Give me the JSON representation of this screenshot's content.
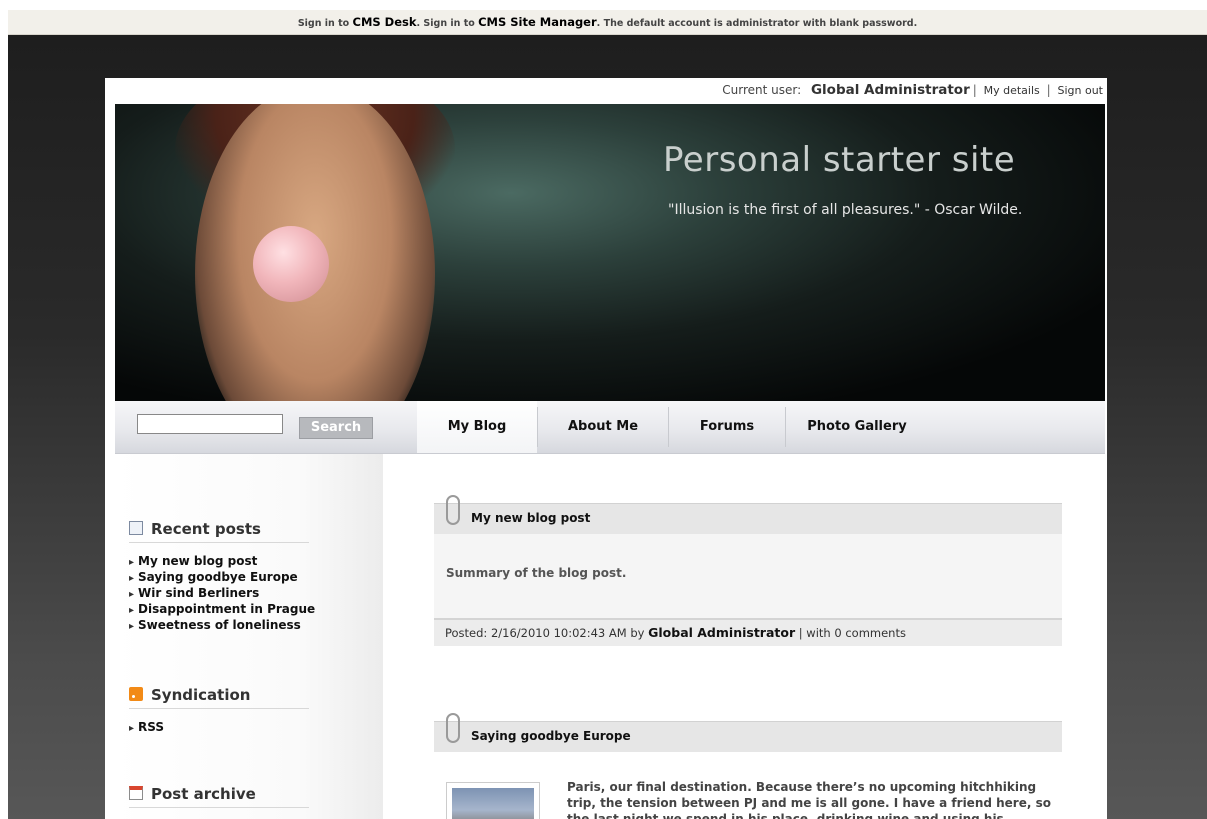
{
  "topbar": {
    "pre1": "Sign in to",
    "cms_desk": "CMS Desk",
    "mid": ". Sign in to",
    "site_manager": "CMS Site Manager",
    "post": ". The default account is administrator with blank password."
  },
  "user": {
    "label": "Current user:",
    "name": "Global Administrator",
    "my_details": "My details",
    "sign_out": "Sign out"
  },
  "banner": {
    "title": "Personal starter site",
    "quote": "\"Illusion is the first of all pleasures.\" - Oscar Wilde."
  },
  "search": {
    "button": "Search",
    "value": ""
  },
  "nav": {
    "items": [
      {
        "label": "My Blog"
      },
      {
        "label": "About Me"
      },
      {
        "label": "Forums"
      },
      {
        "label": "Photo Gallery"
      }
    ]
  },
  "sidebar": {
    "recent_title": "Recent posts",
    "recent": [
      "My new blog post",
      "Saying goodbye Europe",
      "Wir sind Berliners",
      "Disappointment in Prague",
      "Sweetness of loneliness"
    ],
    "syndication_title": "Syndication",
    "syndication": [
      "RSS"
    ],
    "archive_title": "Post archive"
  },
  "posts": [
    {
      "title": "My new blog post",
      "summary": "Summary of the blog post.",
      "posted_label": "Posted: 2/16/2010 10:02:43 AM by",
      "author": "Global Administrator",
      "comments": "| with 0 comments"
    },
    {
      "title": "Saying goodbye Europe",
      "excerpt": "Paris, our final destination. Because there’s no upcoming hitchhiking trip, the tension between PJ and me is all gone. I have a friend here, so the last night we spend in his place, drinking wine and using his"
    }
  ],
  "colors": {
    "page_bg": "#2a2a2a",
    "banner_title": "#c9cfcd",
    "nav_bg": "#e8e9ed",
    "post_header_bg": "#e6e6e6",
    "rss_orange": "#f28a16"
  },
  "icons": {
    "recent": "page-icon",
    "syndication": "rss-icon",
    "archive": "calendar-icon",
    "post": "paperclip-icon"
  }
}
